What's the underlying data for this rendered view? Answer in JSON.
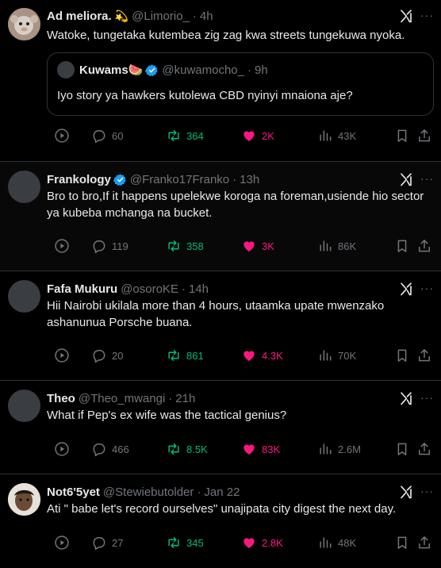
{
  "colors": {
    "background": "#000000",
    "text": "#e7e9ea",
    "muted": "#71767b",
    "retweet": "#00ba7c",
    "like": "#f91880",
    "verified": "#1d9bf0",
    "divider": "#2f3336"
  },
  "tweets": [
    {
      "name": "Ad meliora.",
      "emoji": "💫",
      "handle": "@Limorio_",
      "time": "4h",
      "text": "Watoke, tungetaka kutembea zig zag kwa streets tungekuwa nyoka.",
      "quote": {
        "name": "Kuwams🍉",
        "handle": "@kuwamocho_",
        "time": "9h",
        "text": "Iyo story ya hawkers kutolewa CBD nyinyi mnaiona aje?"
      },
      "replies": "60",
      "retweets": "364",
      "likes": "2K",
      "views": "43K"
    },
    {
      "name": "Frankology",
      "handle": "@Franko17Franko",
      "time": "13h",
      "text": "Bro to bro,If it happens upelekwe koroga na foreman,usiende hio sector ya kubeba mchanga na bucket.",
      "replies": "119",
      "retweets": "358",
      "likes": "3K",
      "views": "86K"
    },
    {
      "name": "Fafa Mukuru",
      "handle": "@osoroKE",
      "time": "14h",
      "text": "Hii Nairobi ukilala more than 4 hours, utaamka upate mwenzako ashanunua Porsche buana.",
      "replies": "20",
      "retweets": "861",
      "likes": "4.3K",
      "views": "70K"
    },
    {
      "name": "Theo",
      "handle": "@Theo_mwangi",
      "time": "21h",
      "text": "What if Pep's ex wife was the tactical genius?",
      "replies": "466",
      "retweets": "8.5K",
      "likes": "83K",
      "views": "2.6M"
    },
    {
      "name": "Not6'5yet",
      "handle": "@Stewiebutolder",
      "time": "Jan 22",
      "text": "Ati \" babe let's record ourselves\" unajipata city digest the next day.",
      "replies": "27",
      "retweets": "345",
      "likes": "2.8K",
      "views": "48K"
    }
  ]
}
